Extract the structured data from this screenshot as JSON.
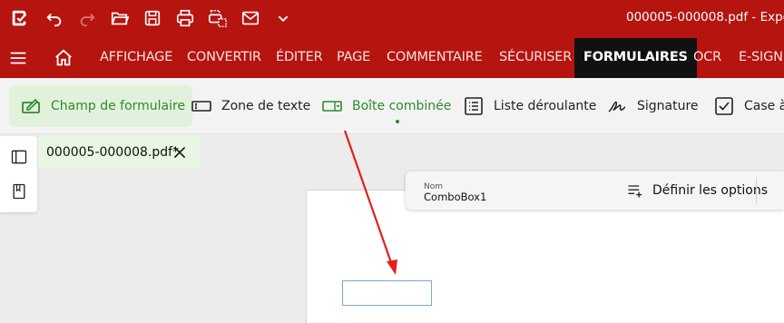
{
  "window": {
    "title": "000005-000008.pdf  -  Expe"
  },
  "colors": {
    "brand": "#b5140f",
    "active_tab_bg": "#111111",
    "accent_green": "#2e8a2e",
    "selected_bg": "#e2f1dc",
    "annotation_arrow": "#e0201b",
    "field_border": "#7fa6c5"
  },
  "quick_access": {
    "icons": [
      "app-logo-icon",
      "undo-icon",
      "redo-icon",
      "open-folder-icon",
      "save-icon",
      "print-icon",
      "scan-icon",
      "email-icon",
      "chevron-down-icon"
    ]
  },
  "menu": {
    "items": [
      {
        "label": "AFFICHAGE"
      },
      {
        "label": "CONVERTIR"
      },
      {
        "label": "ÉDITER"
      },
      {
        "label": "PAGE"
      },
      {
        "label": "COMMENTAIRE"
      },
      {
        "label": "SÉCURISER"
      },
      {
        "label": "FORMULAIRES",
        "active": true
      },
      {
        "label": "OCR"
      },
      {
        "label": "E-SIGN"
      }
    ]
  },
  "ribbon": {
    "items": [
      {
        "label": "Champ de formulaire",
        "icon": "form-field-icon",
        "selected": true
      },
      {
        "label": "Zone de texte",
        "icon": "text-box-icon"
      },
      {
        "label": "Boîte combinée",
        "icon": "combo-box-icon",
        "highlighted": true
      },
      {
        "label": "Liste déroulante",
        "icon": "list-box-icon"
      },
      {
        "label": "Signature",
        "icon": "signature-icon"
      },
      {
        "label": "Case à",
        "icon": "checkbox-icon"
      }
    ]
  },
  "document_tab": {
    "filename": "000005-000008.pdf*"
  },
  "properties": {
    "name_label": "Nom",
    "name_value": "ComboBox1",
    "define_options_label": "Définir les options"
  }
}
